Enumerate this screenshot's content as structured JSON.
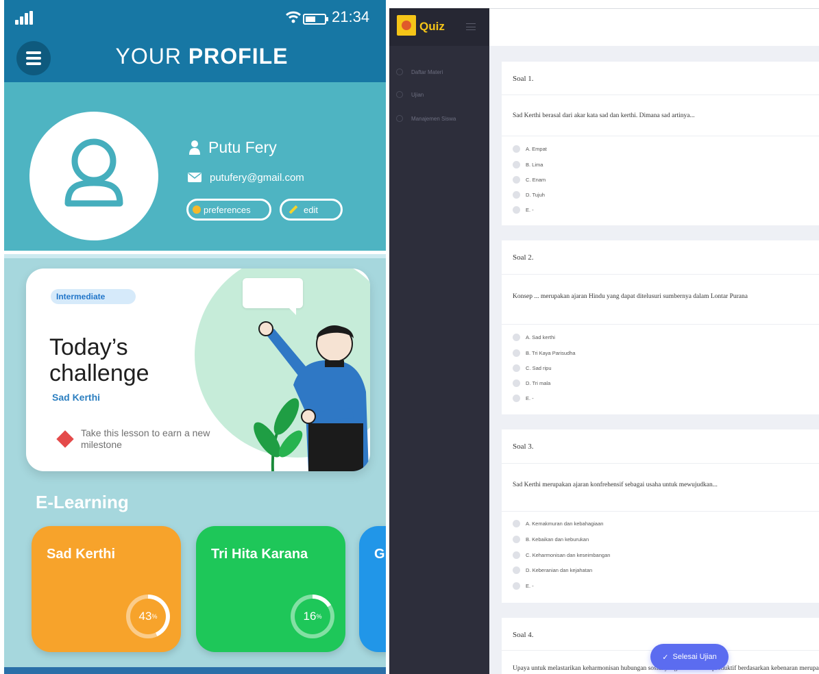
{
  "mobile": {
    "status": {
      "time": "21:34"
    },
    "header": {
      "title_prefix": "YOUR",
      "title_bold": "PROFILE"
    },
    "profile": {
      "name": "Putu Fery",
      "email": "putufery@gmail.com",
      "preferences_label": "preferences",
      "edit_label": "edit"
    },
    "challenge": {
      "badge": "Intermediate",
      "title": "Today’s challenge",
      "topic": "Sad Kerthi",
      "tip": "Take this lesson to earn a new milestone"
    },
    "elearning": {
      "heading": "E-Learning",
      "courses": [
        {
          "title": "Sad Kerthi",
          "progress": "43",
          "percent_sign": "%",
          "progress_fraction": 0.43,
          "color": "#f7a32b"
        },
        {
          "title": "Tri Hita Karana",
          "progress": "16",
          "percent_sign": "%",
          "progress_fraction": 0.16,
          "color": "#1ec759"
        },
        {
          "title": "G",
          "color": "#2196e8"
        }
      ]
    }
  },
  "quiz": {
    "brand": "Quiz",
    "nav": [
      {
        "label": "Daftar Materi"
      },
      {
        "label": "Ujian"
      },
      {
        "label": "Manajemen Siswa"
      }
    ],
    "questions": [
      {
        "title": "Soal 1.",
        "text": "Sad Kerthi berasal dari akar kata sad dan kerthi. Dimana sad artinya...",
        "options": [
          "A. Empat",
          "B. Lima",
          "C. Enam",
          "D. Tujuh",
          "E. -"
        ]
      },
      {
        "title": "Soal 2.",
        "text": "Konsep ... merupakan ajaran Hindu yang dapat ditelusuri sumbernya dalam Lontar Purana",
        "options": [
          "A. Sad kerthi",
          "B. Tri Kaya Parisudha",
          "C. Sad ripu",
          "D. Tri mala",
          "E. -"
        ]
      },
      {
        "title": "Soal 3.",
        "text": "Sad Kerthi merupakan ajaran konfrehensif sebagai usaha untuk mewujudkan...",
        "options": [
          "A. Kemakmuran dan kebahagiaan",
          "B. Kebaikan dan keburukan",
          "C. Keharmonisan dan keseimbangan",
          "D. Keberanian dan kejahatan",
          "E. -"
        ]
      },
      {
        "title": "Soal 4.",
        "text": "Upaya untuk melastarikan keharmonisan hubungan sosial yang dinamis dan produktif berdasarkan kebenaran merupa"
      }
    ],
    "finish_label": "Selesai Ujian",
    "accent": "#5b6cf0"
  }
}
